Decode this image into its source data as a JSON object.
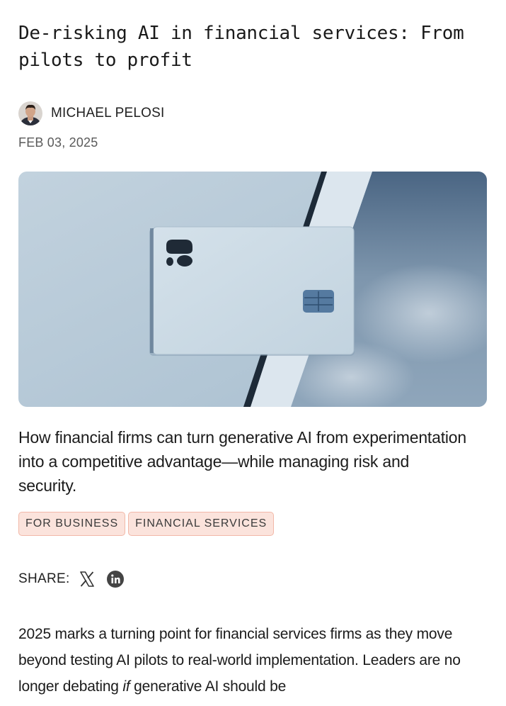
{
  "article": {
    "title": "De-risking AI in financial services: From pilots to profit",
    "author": "MICHAEL PELOSI",
    "date": "FEB 03, 2025",
    "subtitle": "How financial firms can turn generative AI from experimentation into a competitive advantage—while managing risk and security.",
    "tags": [
      "FOR BUSINESS",
      "FINANCIAL SERVICES"
    ],
    "share_label": "SHARE:",
    "share_icons": [
      "x-icon",
      "linkedin-icon"
    ],
    "body": {
      "part1": "2025 marks a turning point for financial services firms as they move beyond testing AI pilots to real-world implementation. Leaders are no longer debating ",
      "emphasis": "if",
      "part2": " generative AI should be"
    }
  },
  "colors": {
    "tag_background": "#fbe3dc",
    "tag_border": "#f2b8a8",
    "text": "#1b1b1b",
    "muted": "#5a5a5a"
  }
}
